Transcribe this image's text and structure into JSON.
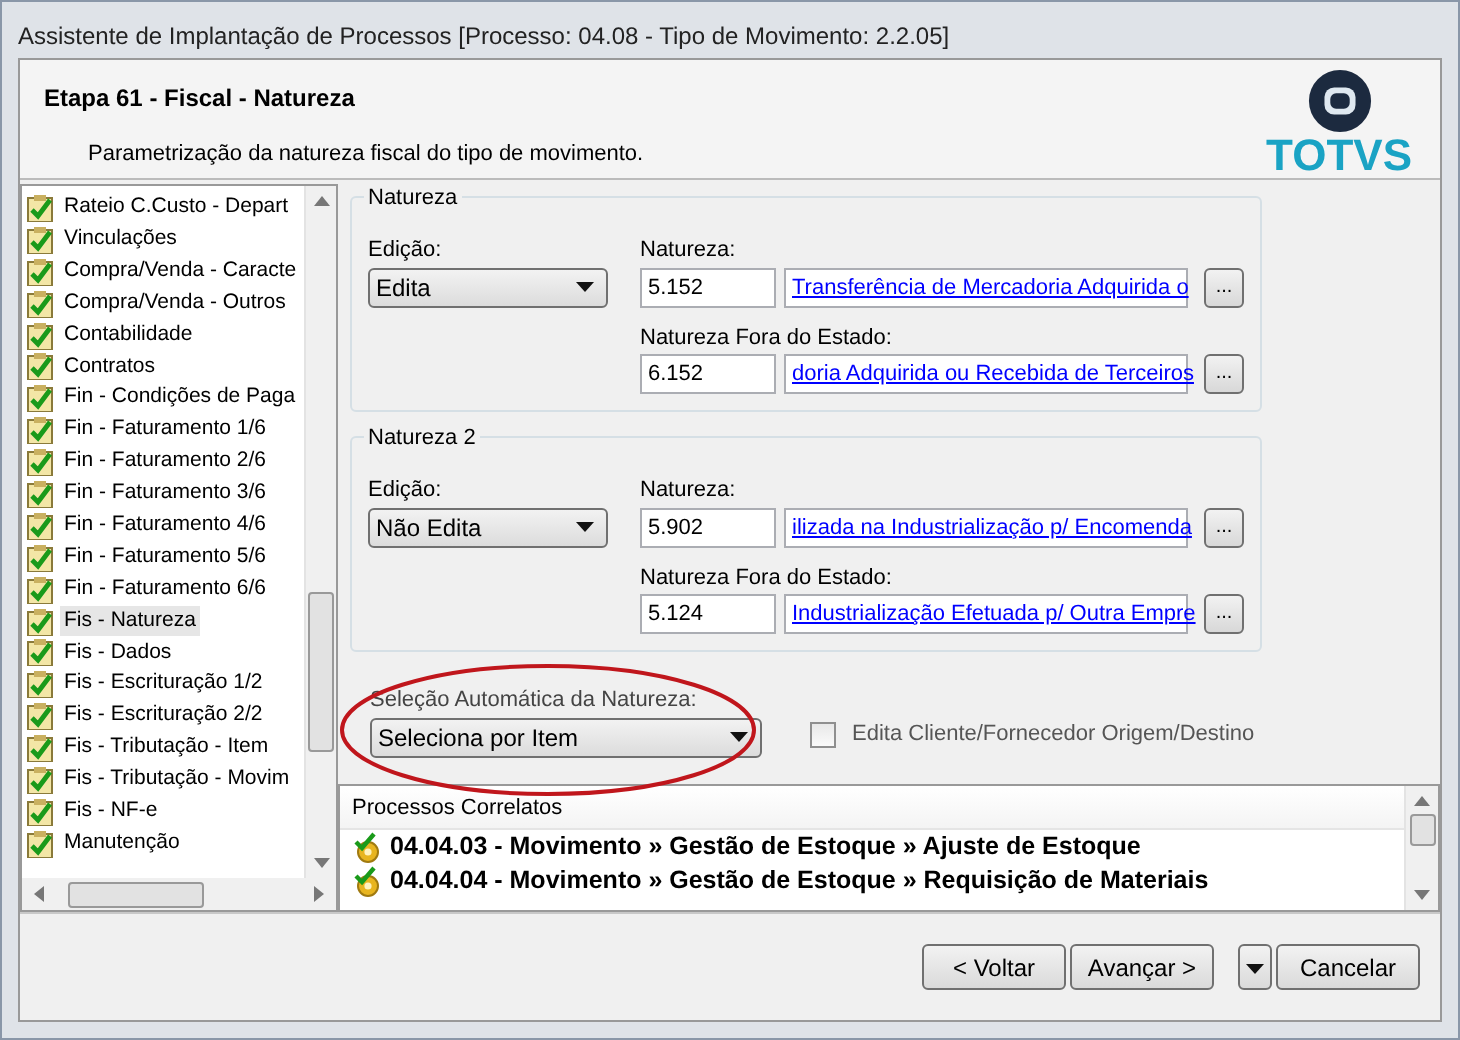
{
  "window": {
    "title": "Assistente de Implantação de Processos [Processo: 04.08 - Tipo de Movimento: 2.2.05]"
  },
  "header": {
    "step": "Etapa 61 - Fiscal - Natureza",
    "description": "Parametrização da natureza fiscal do tipo de movimento.",
    "logo": "TOTVS"
  },
  "steps": [
    {
      "label": "Rateio C.Custo - Depart",
      "done": true,
      "selected": false
    },
    {
      "label": "Vinculações",
      "done": true,
      "selected": false
    },
    {
      "label": "Compra/Venda - Caracte",
      "done": true,
      "selected": false
    },
    {
      "label": "Compra/Venda - Outros",
      "done": true,
      "selected": false
    },
    {
      "label": "Contabilidade",
      "done": true,
      "selected": false
    },
    {
      "label": "Contratos",
      "done": true,
      "selected": false
    },
    {
      "label": "Fin - Condições de Paga",
      "done": true,
      "selected": false
    },
    {
      "label": "Fin - Faturamento 1/6",
      "done": true,
      "selected": false
    },
    {
      "label": "Fin - Faturamento 2/6",
      "done": true,
      "selected": false
    },
    {
      "label": "Fin - Faturamento 3/6",
      "done": true,
      "selected": false
    },
    {
      "label": "Fin - Faturamento 4/6",
      "done": true,
      "selected": false
    },
    {
      "label": "Fin - Faturamento 5/6",
      "done": true,
      "selected": false
    },
    {
      "label": "Fin - Faturamento 6/6",
      "done": true,
      "selected": false
    },
    {
      "label": "Fis - Natureza",
      "done": true,
      "selected": true
    },
    {
      "label": "Fis - Dados",
      "done": true,
      "selected": false
    },
    {
      "label": "Fis - Escrituração 1/2",
      "done": true,
      "selected": false
    },
    {
      "label": "Fis - Escrituração 2/2",
      "done": true,
      "selected": false
    },
    {
      "label": "Fis - Tributação - Item",
      "done": true,
      "selected": false
    },
    {
      "label": "Fis - Tributação - Movim",
      "done": true,
      "selected": false
    },
    {
      "label": "Fis - NF-e",
      "done": true,
      "selected": false
    },
    {
      "label": "Manutenção",
      "done": true,
      "selected": false
    }
  ],
  "groups": [
    {
      "title": "Natureza",
      "edit_label": "Edição:",
      "edit_value": "Edita",
      "fields": [
        {
          "label": "Natureza:",
          "code": "5.152",
          "description": "Transferência de Mercadoria Adquirida o"
        },
        {
          "label": "Natureza Fora do Estado:",
          "code": "6.152",
          "description": "doria Adquirida ou Recebida de Terceiros"
        }
      ]
    },
    {
      "title": "Natureza 2",
      "edit_label": "Edição:",
      "edit_value": "Não Edita",
      "fields": [
        {
          "label": "Natureza:",
          "code": "5.902",
          "description": "ilizada na Industrialização p/ Encomenda"
        },
        {
          "label": "Natureza Fora do Estado:",
          "code": "5.124",
          "description": "Industrialização Efetuada p/ Outra Empre"
        }
      ]
    }
  ],
  "browse_button": "...",
  "auto_selection": {
    "label": "Seleção Automática da Natureza:",
    "value": "Seleciona por Item"
  },
  "edit_client": {
    "label": "Edita Cliente/Fornecedor Origem/Destino",
    "checked": false
  },
  "related": {
    "title": "Processos Correlatos",
    "items": [
      {
        "label": "04.04.03 - Movimento » Gestão de Estoque » Ajuste de Estoque"
      },
      {
        "label": "04.04.04 - Movimento » Gestão de Estoque » Requisição de Materiais"
      }
    ]
  },
  "buttons": [
    {
      "label": "< Voltar"
    },
    {
      "label": "Avançar >"
    },
    {
      "kind": "menu"
    },
    {
      "label": "Cancelar"
    }
  ]
}
